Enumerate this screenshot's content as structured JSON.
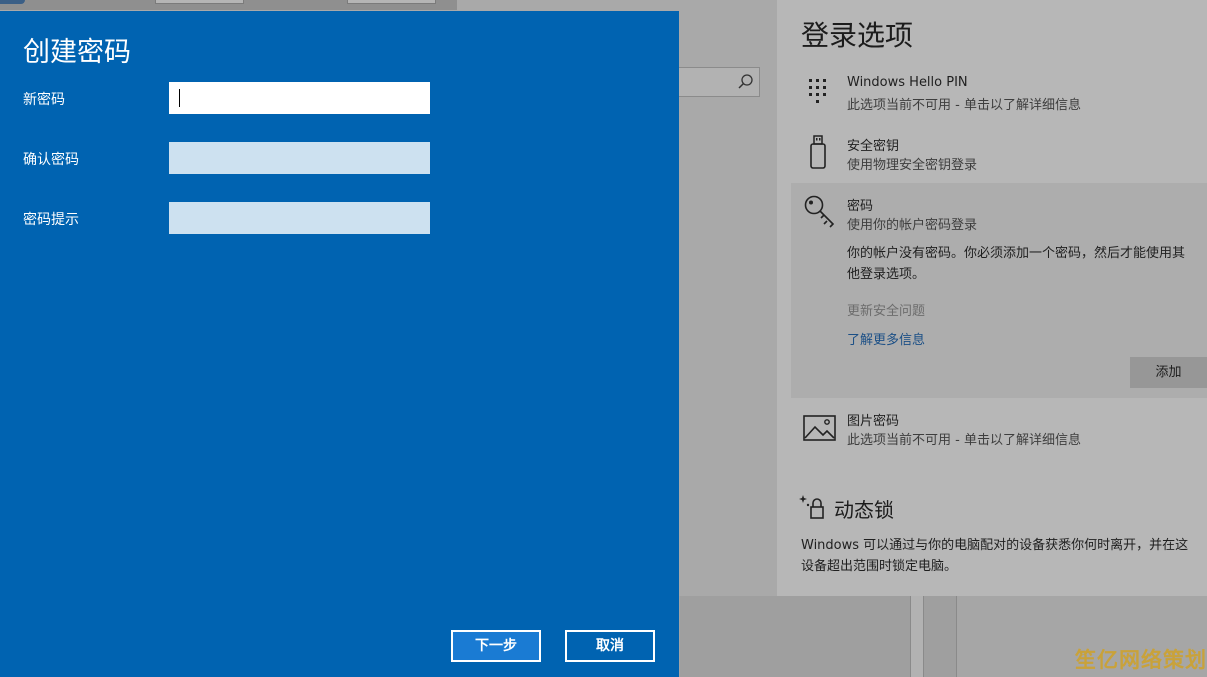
{
  "dialog": {
    "title": "创建密码",
    "fields": [
      {
        "label": "新密码",
        "value": ""
      },
      {
        "label": "确认密码",
        "value": ""
      },
      {
        "label": "密码提示",
        "value": ""
      }
    ],
    "next_label": "下一步",
    "cancel_label": "取消"
  },
  "settings": {
    "title": "登录选项",
    "options": [
      {
        "title": "Windows Hello PIN",
        "subtitle": "此选项当前不可用 - 单击以了解详细信息",
        "icon": "pin-keypad-icon"
      },
      {
        "title": "安全密钥",
        "subtitle": "使用物理安全密钥登录",
        "icon": "usb-key-icon"
      },
      {
        "title": "密码",
        "subtitle": "使用你的帐户密码登录",
        "icon": "key-icon"
      },
      {
        "title": "图片密码",
        "subtitle": "此选项当前不可用 - 单击以了解详细信息",
        "icon": "picture-icon"
      }
    ],
    "password_expanded": {
      "description_line1": "你的帐户没有密码。你必须添加一个密码，然后才能使用其",
      "description_line2": "他登录选项。",
      "security_questions": "更新安全问题",
      "learn_more": "了解更多信息",
      "add_button": "添加"
    },
    "dynamic_lock": {
      "title": "动态锁",
      "description_line1": "Windows 可以通过与你的电脑配对的设备获悉你何时离开，并在这",
      "description_line2": "设备超出范围时锁定电脑。"
    }
  },
  "watermark": "笙亿网络策划",
  "colors": {
    "dialog_bg": "#0063b1",
    "next_button_bg": "#1a7bd3",
    "inactive_input": "#cde1f0",
    "link": "#1b4f86"
  }
}
